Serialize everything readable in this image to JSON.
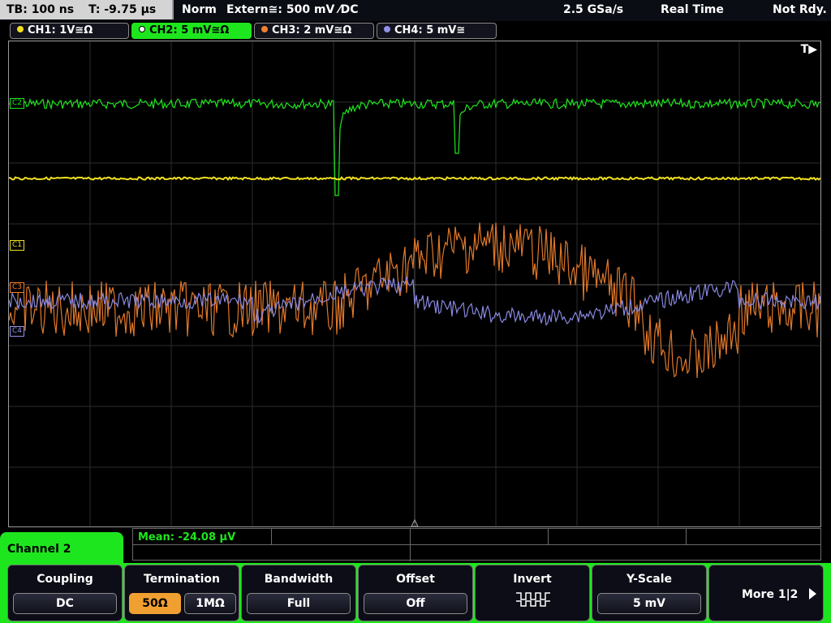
{
  "status": {
    "timebase": "TB: 100 ns",
    "trigger_time": "T: -9.75 µs",
    "mode": "Norm",
    "trigger_source": "Extern≅: 500 mV ⁄DC",
    "sample_rate": "2.5 GSa/s",
    "acq_mode": "Real Time",
    "state": "Not Rdy."
  },
  "channels": [
    {
      "label": "CH1: 1V≅Ω",
      "color": "#f0e020"
    },
    {
      "label": "CH2: 5 mV≅Ω",
      "color": "#1ee61e"
    },
    {
      "label": "CH3: 2 mV≅Ω",
      "color": "#f08030"
    },
    {
      "label": "CH4: 5 mV≅",
      "color": "#9090e8"
    }
  ],
  "markers": {
    "c2": "C2",
    "c1": "C1",
    "c3": "C3",
    "c4": "C4"
  },
  "trigger_marker": "T▶",
  "measurement": {
    "label": "Mean: -24.08 µV"
  },
  "panel_title": "Channel 2",
  "softkeys": {
    "coupling": {
      "title": "Coupling",
      "value": "DC"
    },
    "termination": {
      "title": "Termination",
      "opt1": "50Ω",
      "opt2": "1MΩ"
    },
    "bandwidth": {
      "title": "Bandwidth",
      "value": "Full"
    },
    "offset": {
      "title": "Offset",
      "value": "Off"
    },
    "invert": {
      "title": "Invert"
    },
    "yscale": {
      "title": "Y-Scale",
      "value": "5 mV"
    },
    "more": {
      "label": "More 1|2"
    }
  }
}
